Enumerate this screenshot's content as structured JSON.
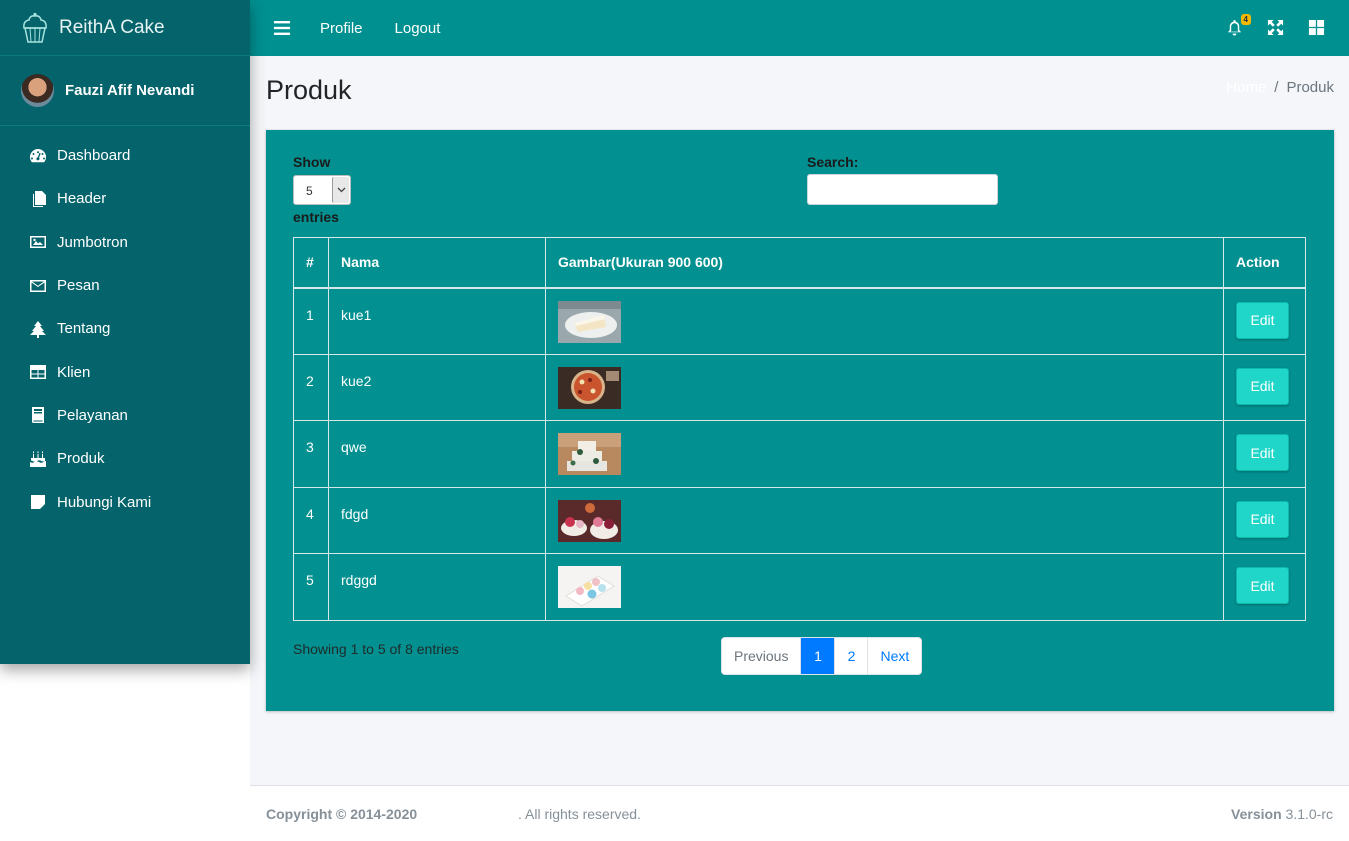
{
  "brand": {
    "name": "ReithA Cake"
  },
  "user": {
    "name": "Fauzi Afif Nevandi"
  },
  "sidebar": {
    "items": [
      {
        "label": "Dashboard",
        "icon": "tachometer-icon"
      },
      {
        "label": "Header",
        "icon": "copy-icon"
      },
      {
        "label": "Jumbotron",
        "icon": "image-icon"
      },
      {
        "label": "Pesan",
        "icon": "envelope-icon"
      },
      {
        "label": "Tentang",
        "icon": "tree-icon"
      },
      {
        "label": "Klien",
        "icon": "table-icon"
      },
      {
        "label": "Pelayanan",
        "icon": "book-icon"
      },
      {
        "label": "Produk",
        "icon": "birthday-cake-icon"
      },
      {
        "label": "Hubungi Kami",
        "icon": "sticky-note-icon"
      }
    ]
  },
  "topbar": {
    "profile": "Profile",
    "logout": "Logout",
    "notification_count": "4"
  },
  "page": {
    "title": "Produk",
    "breadcrumb": {
      "home": "Home",
      "current": "Produk"
    }
  },
  "datatable": {
    "show_label": "Show",
    "length_value": "5",
    "entries_label": "entries",
    "search_label": "Search:",
    "search_value": "",
    "columns": [
      "#",
      "Nama",
      "Gambar(Ukuran 900 600)",
      "Action"
    ],
    "rows": [
      {
        "num": "1",
        "name": "kue1",
        "image": "cake-slice-photo",
        "action": "Edit"
      },
      {
        "num": "2",
        "name": "kue2",
        "image": "pizza-tart-photo",
        "action": "Edit"
      },
      {
        "num": "3",
        "name": "qwe",
        "image": "wedding-cake-photo",
        "action": "Edit"
      },
      {
        "num": "4",
        "name": "fdgd",
        "image": "cupcakes-photo",
        "action": "Edit"
      },
      {
        "num": "5",
        "name": "rdggd",
        "image": "macarons-photo",
        "action": "Edit"
      }
    ],
    "info": "Showing 1 to 5 of 8 entries",
    "pagination": {
      "previous": "Previous",
      "pages": [
        "1",
        "2"
      ],
      "active": "1",
      "next": "Next"
    }
  },
  "footer": {
    "copyright": "Copyright © 2014-2020",
    "rights": ". All rights reserved.",
    "version_label": "Version",
    "version_value": "3.1.0-rc"
  },
  "colors": {
    "sidebar_bg": "#04636b",
    "topbar_bg": "#009090",
    "card_bg": "#029090",
    "edit_button": "#1fd6c9",
    "page_active": "#007bff",
    "badge": "#f5b800"
  }
}
